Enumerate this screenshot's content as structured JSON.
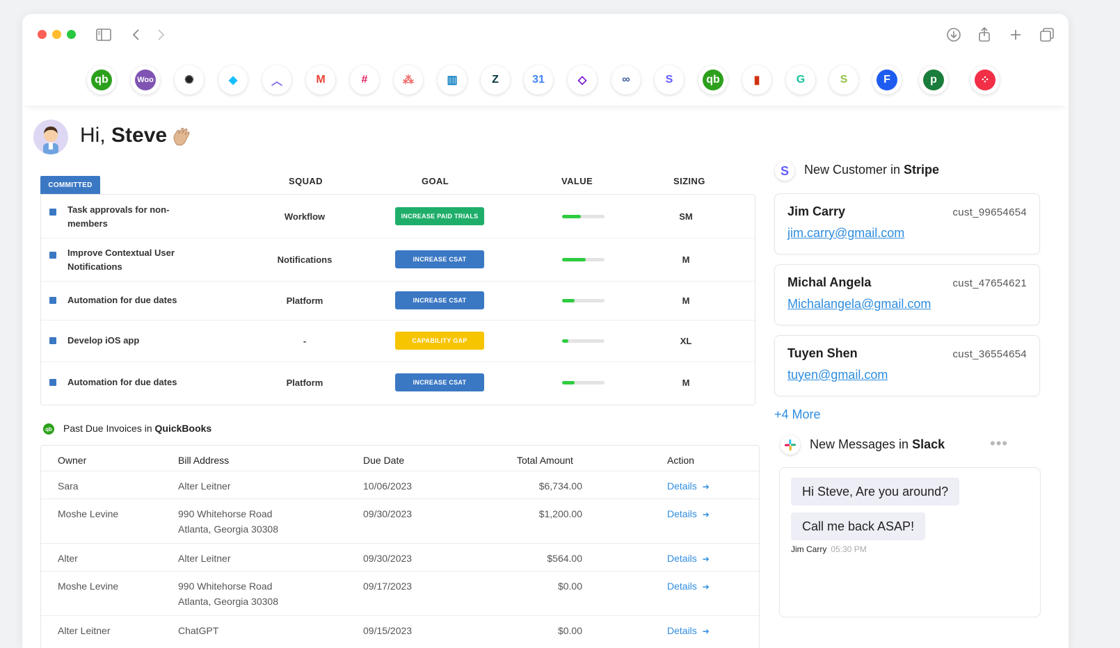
{
  "greeting": {
    "hi": "Hi,",
    "name": "Steve"
  },
  "apps": [
    {
      "name": "quickbooks",
      "label": "qb",
      "color": "#2ca01c",
      "text": "#fff",
      "bg": "#2ca01c"
    },
    {
      "name": "woocommerce",
      "label": "Woo",
      "color": "#7f54b3",
      "text": "#fff",
      "bg": "#7f54b3"
    },
    {
      "name": "openai",
      "label": "✺",
      "color": "#222",
      "text": "#222",
      "bg": "#fff"
    },
    {
      "name": "airtable",
      "label": "◆",
      "color": "#fcb400",
      "text": "#18bfff",
      "bg": "#fff"
    },
    {
      "name": "clickup",
      "label": "︿",
      "color": "#7b68ee",
      "text": "#7b68ee",
      "bg": "#fff"
    },
    {
      "name": "gmail",
      "label": "M",
      "color": "#ea4335",
      "text": "#ea4335",
      "bg": "#fff"
    },
    {
      "name": "slack",
      "label": "#",
      "color": "#e01e5a",
      "text": "#e01e5a",
      "bg": "#fff"
    },
    {
      "name": "asana",
      "label": "⁂",
      "color": "#f06a6a",
      "text": "#f06a6a",
      "bg": "#fff"
    },
    {
      "name": "trello",
      "label": "▥",
      "color": "#0079bf",
      "text": "#0079bf",
      "bg": "#fff"
    },
    {
      "name": "zendesk",
      "label": "Z",
      "color": "#03363d",
      "text": "#03363d",
      "bg": "#fff"
    },
    {
      "name": "google-calendar",
      "label": "31",
      "color": "#4285f4",
      "text": "#4285f4",
      "bg": "#fff"
    },
    {
      "name": "make",
      "label": "◇",
      "color": "#6d00cc",
      "text": "#6d00cc",
      "bg": "#fff"
    },
    {
      "name": "bitly-link",
      "label": "∞",
      "color": "#3d5a98",
      "text": "#3d5a98",
      "bg": "#fff"
    },
    {
      "name": "stripe",
      "label": "S",
      "color": "#635bff",
      "text": "#635bff",
      "bg": "#fff"
    },
    {
      "name": "quickbooks-2",
      "label": "qb",
      "color": "#2ca01c",
      "text": "#fff",
      "bg": "#2ca01c"
    },
    {
      "name": "aws-s3",
      "label": "▮",
      "color": "#d13212",
      "text": "#d13212",
      "bg": "#fff"
    },
    {
      "name": "grammarly",
      "label": "G",
      "color": "#15c39a",
      "text": "#15c39a",
      "bg": "#fff"
    },
    {
      "name": "shopify",
      "label": "S",
      "color": "#95bf47",
      "text": "#95bf47",
      "bg": "#fff"
    },
    {
      "name": "freshdesk",
      "label": "F",
      "color": "#1e5cf0",
      "text": "#fff",
      "bg": "#1e5cf0"
    },
    {
      "name": "pipedrive",
      "label": "p",
      "color": "#1a7d3b",
      "text": "#fff",
      "bg": "#1a7d3b"
    },
    {
      "name": "twilio",
      "label": "⁘",
      "color": "#f22f46",
      "text": "#fff",
      "bg": "#f22f46"
    }
  ],
  "committed": {
    "tag": "COMMITTED",
    "headers": {
      "squad": "SQUAD",
      "goal": "GOAL",
      "value": "VALUE",
      "sizing": "SIZING"
    },
    "rows": [
      {
        "task": "Task approvals for non-members",
        "squad": "Workflow",
        "goal": "INCREASE PAID TRIALS",
        "goal_color": "#1fae6a",
        "value": 0.45,
        "sizing": "SM"
      },
      {
        "task": "Improve Contextual User Notifications",
        "squad": "Notifications",
        "goal": "INCREASE CSAT",
        "goal_color": "#3b78c4",
        "value": 0.55,
        "sizing": "M"
      },
      {
        "task": "Automation for due dates",
        "squad": "Platform",
        "goal": "INCREASE CSAT",
        "goal_color": "#3b78c4",
        "value": 0.3,
        "sizing": "M"
      },
      {
        "task": "Develop iOS app",
        "squad": "-",
        "goal": "CAPABILITY GAP",
        "goal_color": "#f7c400",
        "value": 0.15,
        "sizing": "XL"
      },
      {
        "task": "Automation for due dates",
        "squad": "Platform",
        "goal": "INCREASE CSAT",
        "goal_color": "#3b78c4",
        "value": 0.3,
        "sizing": "M"
      }
    ]
  },
  "invoices": {
    "title_pre": "Past Due Invoices in ",
    "title_app": "QuickBooks",
    "headers": {
      "owner": "Owner",
      "bill": "Bill Address",
      "due": "Due Date",
      "total": "Total Amount",
      "action": "Action"
    },
    "rows": [
      {
        "owner": "Sara",
        "bill": "Alter Leitner",
        "due": "10/06/2023",
        "total": "$6,734.00",
        "action": "Details"
      },
      {
        "owner": "Moshe Levine",
        "bill": "990 Whitehorse Road Atlanta, Georgia 30308",
        "due": "09/30/2023",
        "total": "$1,200.00",
        "action": "Details"
      },
      {
        "owner": "Alter",
        "bill": "Alter Leitner",
        "due": "09/30/2023",
        "total": "$564.00",
        "action": "Details"
      },
      {
        "owner": "Moshe Levine",
        "bill": "990 Whitehorse Road Atlanta, Georgia 30308",
        "due": "09/17/2023",
        "total": "$0.00",
        "action": "Details"
      },
      {
        "owner": "Alter Leitner",
        "bill": "ChatGPT",
        "due": "09/15/2023",
        "total": "$0.00",
        "action": "Details"
      }
    ]
  },
  "stripe": {
    "title_pre": "New Customer in ",
    "title_app": "Stripe",
    "customers": [
      {
        "name": "Jim Carry",
        "id": "cust_99654654",
        "email": "jim.carry@gmail.com"
      },
      {
        "name": "Michal Angela",
        "id": "cust_47654621",
        "email": "Michalangela@gmail.com"
      },
      {
        "name": "Tuyen Shen",
        "id": "cust_36554654",
        "email": "tuyen@gmail.com"
      }
    ],
    "more": "+4 More"
  },
  "slack": {
    "title_pre": "New Messages in ",
    "title_app": "Slack",
    "messages": [
      "Hi Steve, Are you around?",
      "Call me back ASAP!"
    ],
    "sender": "Jim Carry",
    "time": "05:30 PM"
  }
}
